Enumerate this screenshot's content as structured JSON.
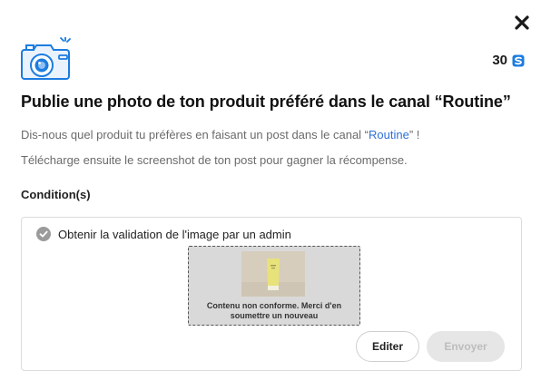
{
  "header": {
    "close_icon": "close-icon",
    "points_value": "30",
    "points_icon": "coin-icon",
    "accent_color": "#1c7ce0"
  },
  "title": "Publie une photo de ton produit préféré dans le canal “Routine”",
  "description": {
    "line1_before": "Dis-nous quel produit tu préfères en faisant un post dans le canal “",
    "line1_link": "Routine",
    "line1_after": "” !",
    "line2": "Télécharge ensuite le screenshot de ton post pour gagner la récompense."
  },
  "conditions": {
    "label": "Condition(s)",
    "items": [
      {
        "text": "Obtenir la validation de l'image par un admin",
        "status_icon": "check-circle-icon",
        "preview_message": "Contenu non conforme. Merci d'en soumettre un nouveau"
      }
    ]
  },
  "actions": {
    "edit_label": "Editer",
    "send_label": "Envoyer"
  }
}
